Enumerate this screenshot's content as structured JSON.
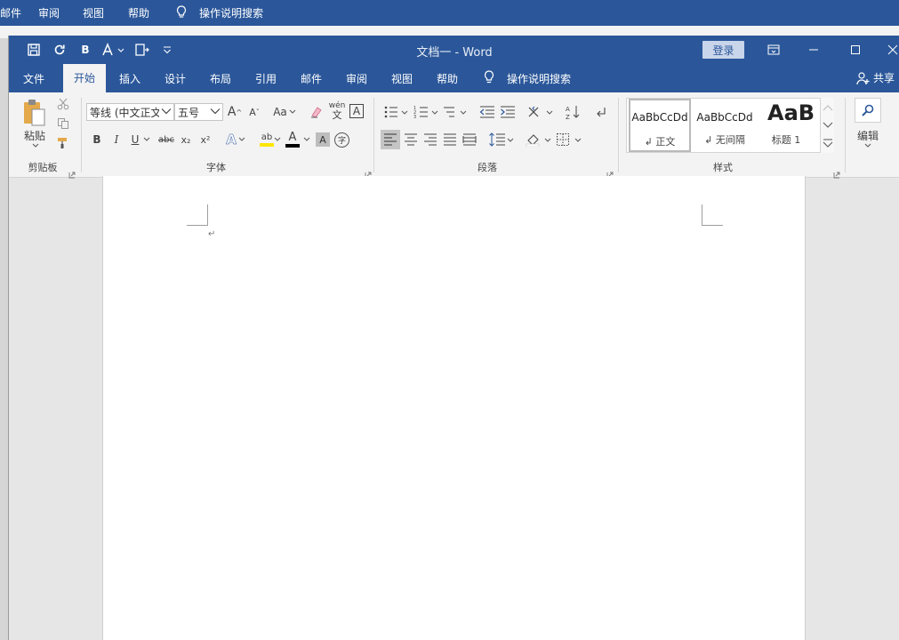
{
  "background_ribbon": {
    "items": [
      "邮件",
      "审阅",
      "视图",
      "帮助",
      "操作说明搜索"
    ]
  },
  "window": {
    "title": "文档一 - Word",
    "login": "登录",
    "colors": {
      "accent": "#2b579a",
      "ribbon": "#f3f3f3"
    }
  },
  "qat": {
    "bold": "B"
  },
  "tabs": [
    "文件",
    "开始",
    "插入",
    "设计",
    "布局",
    "引用",
    "邮件",
    "审阅",
    "视图",
    "帮助",
    "操作说明搜索"
  ],
  "active_tab": "开始",
  "share": "共享",
  "clipboard": {
    "paste": "粘贴",
    "label": "剪贴板"
  },
  "font": {
    "family": "等线 (中文正文)",
    "size": "五号",
    "label": "字体",
    "bold": "B",
    "italic": "I",
    "underline": "U",
    "strike": "abc",
    "subscript": "x₂",
    "superscript": "x²",
    "grow": "A",
    "shrink": "A",
    "change_case": "Aa",
    "phonetic": "wén",
    "phonetic_sub": "文",
    "border_char": "A",
    "effects": "A",
    "highlight": "ab",
    "color": "A",
    "shade": "A",
    "enclose": "字"
  },
  "paragraph": {
    "label": "段落"
  },
  "styles": {
    "label": "样式",
    "items": [
      {
        "preview": "AaBbCcDd",
        "name": "↲ 正文"
      },
      {
        "preview": "AaBbCcDd",
        "name": "↲ 无间隔"
      },
      {
        "preview": "AaBl",
        "name": "标题 1"
      }
    ]
  },
  "editing": {
    "label": "编辑"
  },
  "document": {
    "paragraph_mark": "↵"
  }
}
